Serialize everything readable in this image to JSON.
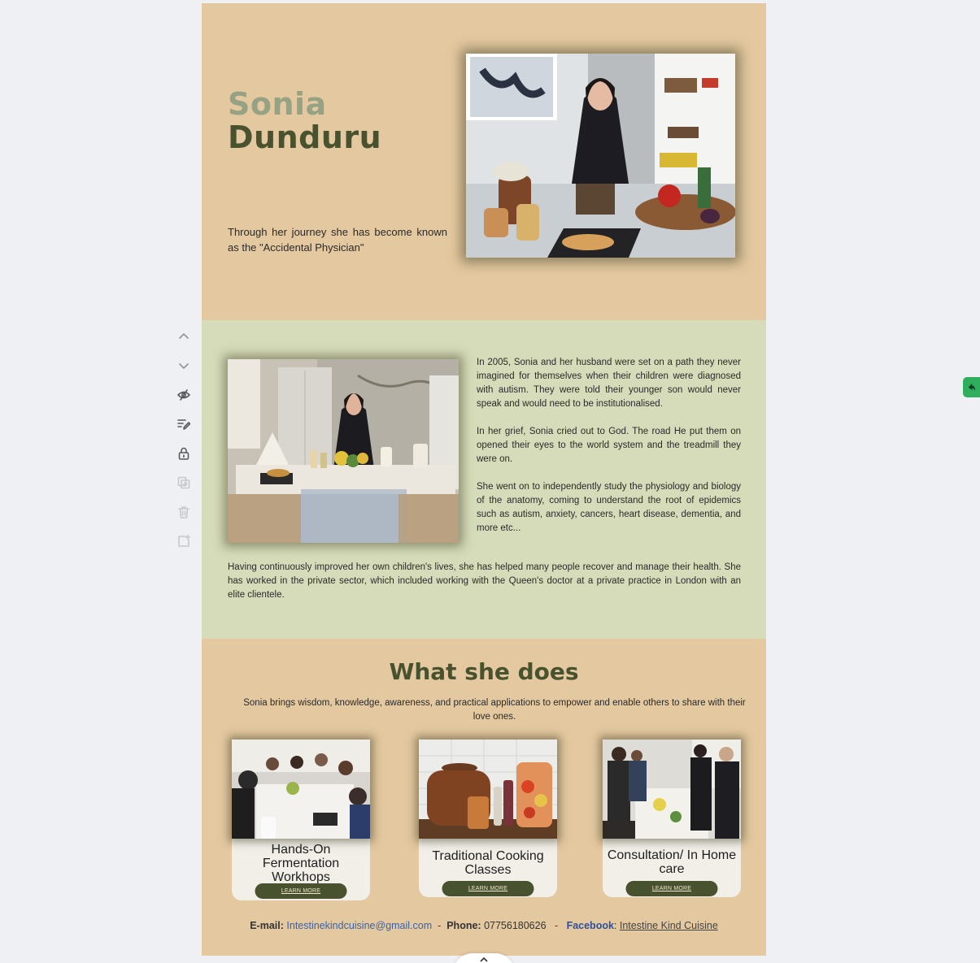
{
  "hero": {
    "first_name": "Sonia",
    "last_name": "Dunduru",
    "tagline": "Through her journey she has become known as  the \"Accidental Physician\""
  },
  "about": {
    "paragraphs": [
      "In 2005, Sonia and her husband were set on a path they never imagined for themselves when their children were diagnosed with autism. They were told their younger son would never speak and would need to be institutionalised.",
      "In her grief, Sonia cried out to God.  The road He put them on opened their eyes to the world system and the treadmill they were on.",
      "She went on to independently study the physiology and biology of the anatomy, coming to understand the root of epidemics such as autism, anxiety, cancers, heart disease, dementia, and more etc..."
    ],
    "bottom": "Having continuously improved her own children's lives, she has helped many people recover and manage their health. She has worked in the private sector, which included working with the Queen's doctor at a private practice in London with an elite clientele."
  },
  "does": {
    "title": "What she does",
    "subtitle": "Sonia brings wisdom, knowledge, awareness, and practical applications to empower and enable others to share with their love ones.",
    "cards": [
      {
        "title": "Hands-On Fermentation Workhops",
        "button": "LEARN MORE"
      },
      {
        "title": "Traditional Cooking Classes",
        "button": "LEARN MORE"
      },
      {
        "title": "Consultation/ In Home care",
        "button": "LEARN MORE"
      }
    ]
  },
  "contact": {
    "email_label": "E-mail:",
    "email": "Intestinekindcuisine@gmail.com",
    "sep": "-",
    "phone_label": "Phone:",
    "phone": "07756180626",
    "facebook_label": "Facebook",
    "facebook": "Intestine Kind Cuisine"
  },
  "toolbar": {
    "icons": [
      "chevron-up-icon",
      "chevron-down-icon",
      "hide-icon",
      "edit-icon",
      "lock-icon",
      "duplicate-icon",
      "trash-icon",
      "add-page-icon"
    ]
  },
  "colors": {
    "beige": "#e4c8a0",
    "sage": "#d6dcb9",
    "olive": "#49522f",
    "sage_text": "#95a283"
  }
}
